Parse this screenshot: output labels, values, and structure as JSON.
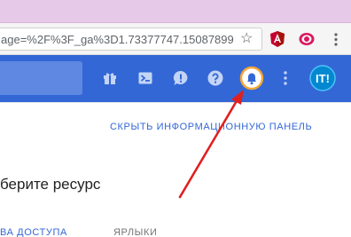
{
  "browser": {
    "address_bar": {
      "url_text": "age=%2F%3F_ga%3D1.73377747.15087899"
    },
    "icons": {
      "bookmark": "star-icon",
      "extension_1": "angular-devtools-icon",
      "extension_2": "eye-extension-icon",
      "menu": "more-vert-icon"
    }
  },
  "appbar": {
    "icons": [
      "gift-icon",
      "cloud-shell-icon",
      "feedback-icon",
      "help-icon",
      "notifications-bell-icon",
      "more-vert-icon",
      "avatar"
    ],
    "avatar_text": "IT!"
  },
  "page": {
    "hide_panel_link": "СКРЫТЬ ИНФОРМАЦИОННУЮ ПАНЕЛЬ",
    "resource_title": "берите ресурс",
    "tabs": [
      {
        "label": "ВА ДОСТУПА"
      },
      {
        "label": "ЯРЛЫКИ"
      }
    ]
  },
  "colors": {
    "appbar": "#3367d6",
    "annotation_arrow": "#e01f1f",
    "notification_ring": "#f4a636",
    "tabstrip": "#e6c8e9"
  }
}
